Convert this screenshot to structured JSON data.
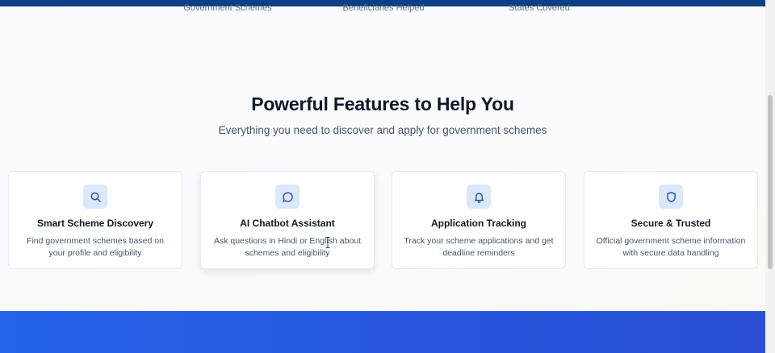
{
  "stats": [
    {
      "label": "Government Schemes"
    },
    {
      "label": "Beneficiaries Helped"
    },
    {
      "label": "States Covered"
    }
  ],
  "features": {
    "title": "Powerful Features to Help You",
    "subtitle": "Everything you need to discover and apply for government schemes",
    "cards": [
      {
        "icon": "search-icon",
        "title": "Smart Scheme Discovery",
        "description": "Find government schemes based on your profile and eligibility"
      },
      {
        "icon": "chat-icon",
        "title": "AI Chatbot Assistant",
        "description": "Ask questions in Hindi or English about schemes and eligibility"
      },
      {
        "icon": "bell-icon",
        "title": "Application Tracking",
        "description": "Track your scheme applications and get deadline reminders"
      },
      {
        "icon": "shield-icon",
        "title": "Secure & Trusted",
        "description": "Official government scheme information with secure data handling"
      }
    ]
  },
  "colors": {
    "accent": "#2563eb",
    "header": "#0c3f86",
    "icon_bg": "#dbe7fb",
    "icon_stroke": "#1e4fae"
  }
}
